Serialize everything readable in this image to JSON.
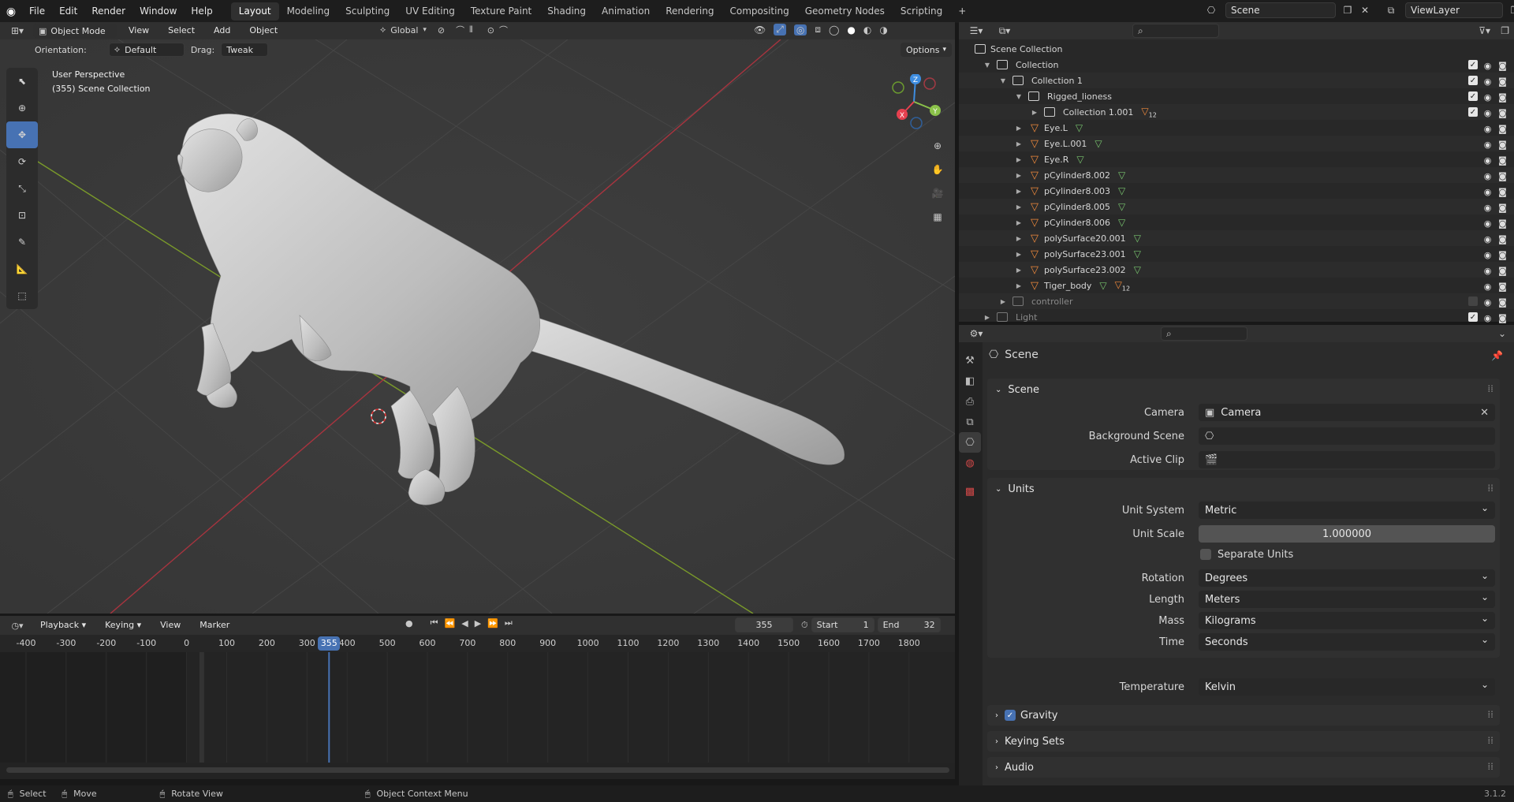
{
  "topbar": {
    "menus": [
      "File",
      "Edit",
      "Render",
      "Window",
      "Help"
    ],
    "workspaces": [
      "Layout",
      "Modeling",
      "Sculpting",
      "UV Editing",
      "Texture Paint",
      "Shading",
      "Animation",
      "Rendering",
      "Compositing",
      "Geometry Nodes",
      "Scripting"
    ],
    "active_workspace": "Layout",
    "scene": "Scene",
    "view_layer": "ViewLayer"
  },
  "viewport": {
    "mode": "Object Mode",
    "menus": [
      "View",
      "Select",
      "Add",
      "Object"
    ],
    "transform_orientation": "Global",
    "orientation_label": "Orientation:",
    "orientation_value": "Default",
    "drag_label": "Drag:",
    "drag_value": "Tweak",
    "options_label": "Options",
    "overlay_line1": "User Perspective",
    "overlay_line2": "(355) Scene Collection",
    "axes": {
      "x": "X",
      "y": "Y",
      "z": "Z"
    }
  },
  "timeline": {
    "menus": [
      "Playback",
      "Keying",
      "View",
      "Marker"
    ],
    "current_frame": "355",
    "start_label": "Start",
    "start": "1",
    "end_label": "End",
    "end": "32",
    "ticks": [
      "-400",
      "-300",
      "-200",
      "-100",
      "0",
      "100",
      "200",
      "300",
      "400",
      "500",
      "600",
      "700",
      "800",
      "900",
      "1000",
      "1100",
      "1200",
      "1300",
      "1400",
      "1500",
      "1600",
      "1700",
      "1800"
    ],
    "playhead": "355"
  },
  "outliner": {
    "root": "Scene Collection",
    "items": [
      {
        "label": "Collection",
        "indent": 0,
        "kind": "collection"
      },
      {
        "label": "Collection 1",
        "indent": 1,
        "kind": "collection"
      },
      {
        "label": "Rigged_lioness",
        "indent": 2,
        "kind": "collection"
      },
      {
        "label": "Collection 1.001",
        "indent": 3,
        "kind": "collection",
        "badge": "12"
      },
      {
        "label": "Eye.L",
        "indent": 2,
        "kind": "mesh"
      },
      {
        "label": "Eye.L.001",
        "indent": 2,
        "kind": "mesh"
      },
      {
        "label": "Eye.R",
        "indent": 2,
        "kind": "mesh"
      },
      {
        "label": "pCylinder8.002",
        "indent": 2,
        "kind": "mesh"
      },
      {
        "label": "pCylinder8.003",
        "indent": 2,
        "kind": "mesh"
      },
      {
        "label": "pCylinder8.005",
        "indent": 2,
        "kind": "mesh"
      },
      {
        "label": "pCylinder8.006",
        "indent": 2,
        "kind": "mesh"
      },
      {
        "label": "polySurface20.001",
        "indent": 2,
        "kind": "mesh"
      },
      {
        "label": "polySurface23.001",
        "indent": 2,
        "kind": "mesh"
      },
      {
        "label": "polySurface23.002",
        "indent": 2,
        "kind": "mesh"
      },
      {
        "label": "Tiger_body",
        "indent": 2,
        "kind": "mesh",
        "badge": "12"
      },
      {
        "label": "controller",
        "indent": 1,
        "kind": "collection-dim"
      },
      {
        "label": "Light",
        "indent": 0,
        "kind": "collection-dim"
      }
    ]
  },
  "properties": {
    "context": "Scene",
    "scene_panel": {
      "title": "Scene",
      "camera_label": "Camera",
      "camera_value": "Camera",
      "bg_label": "Background Scene",
      "bg_value": "",
      "clip_label": "Active Clip",
      "clip_value": ""
    },
    "units_panel": {
      "title": "Units",
      "unit_system_label": "Unit System",
      "unit_system": "Metric",
      "unit_scale_label": "Unit Scale",
      "unit_scale": "1.000000",
      "separate_units": "Separate Units",
      "rotation_label": "Rotation",
      "rotation": "Degrees",
      "length_label": "Length",
      "length": "Meters",
      "mass_label": "Mass",
      "mass": "Kilograms",
      "time_label": "Time",
      "time": "Seconds",
      "temp_label": "Temperature",
      "temp": "Kelvin"
    },
    "collapsed_panels": [
      "Gravity",
      "Keying Sets",
      "Audio"
    ]
  },
  "status": {
    "select": "Select",
    "move": "Move",
    "rotate": "Rotate View",
    "context": "Object Context Menu",
    "version": "3.1.2"
  },
  "colors": {
    "accent": "#4772b3",
    "x_axis": "#e6404f",
    "y_axis": "#8bc24a",
    "z_axis": "#3e8de0"
  }
}
